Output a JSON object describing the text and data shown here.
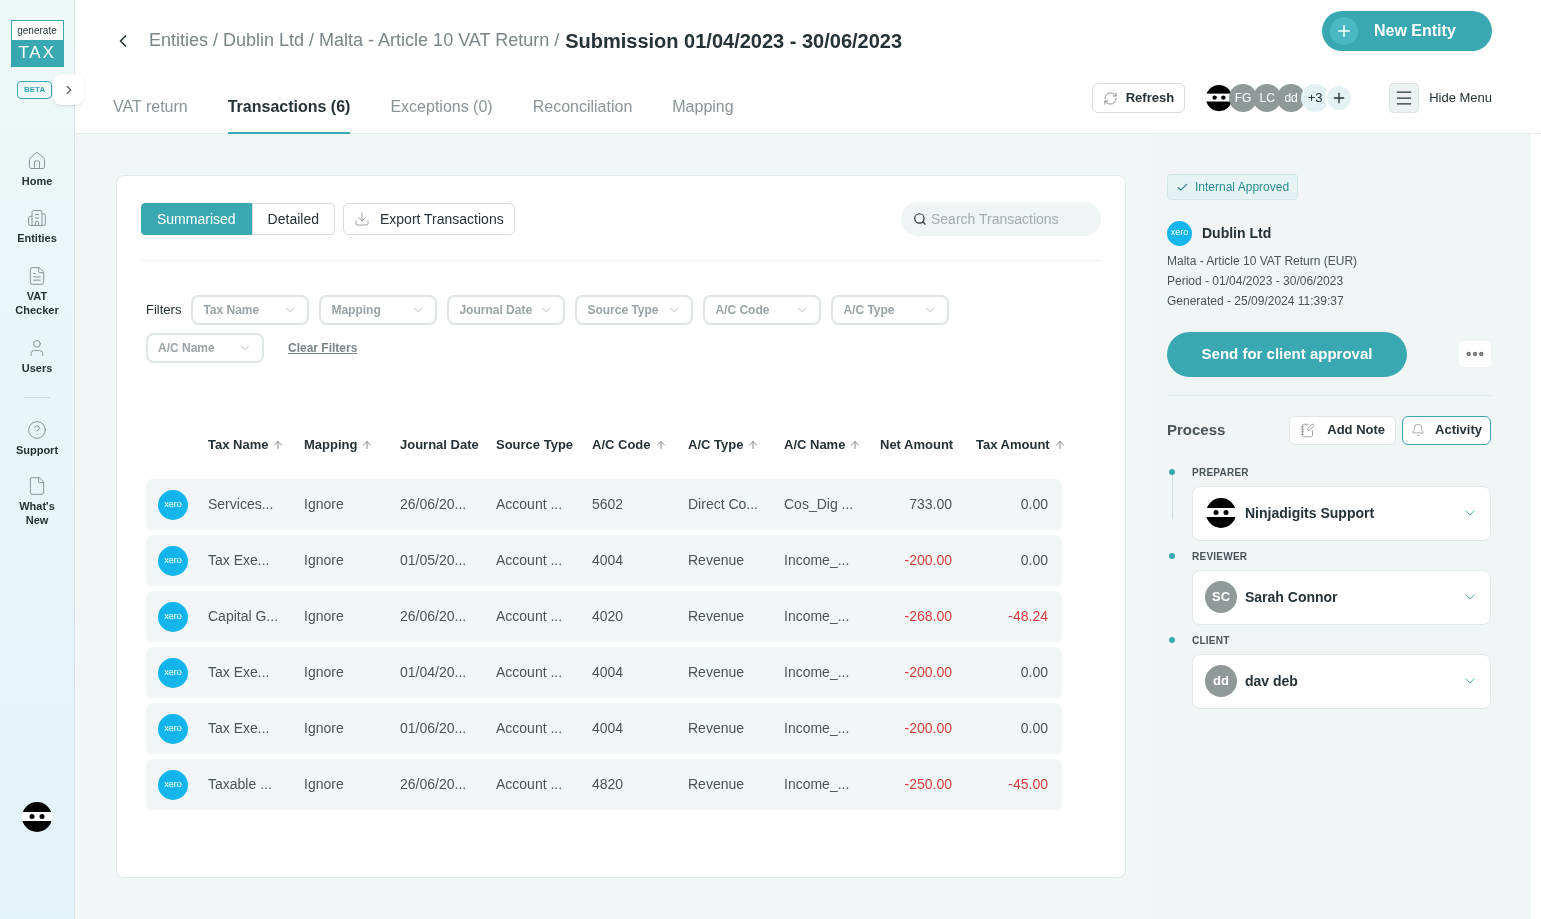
{
  "logo": {
    "top": "generate",
    "bottom": "TAX",
    "badge": "BETA"
  },
  "sidebar": {
    "items": [
      {
        "label": "Home"
      },
      {
        "label": "Entities"
      },
      {
        "label": "VAT Checker"
      },
      {
        "label": "Users"
      }
    ],
    "bottom_items": [
      {
        "label": "Support"
      },
      {
        "label": "What's New"
      }
    ]
  },
  "breadcrumb": {
    "path": "Entities / Dublin Ltd / Malta - Article 10 VAT Return /",
    "current": "Submission 01/04/2023 - 30/06/2023"
  },
  "new_entity_button": "New Entity",
  "tabs": [
    {
      "label": "VAT return",
      "selected": false
    },
    {
      "label": "Transactions (6)",
      "selected": true
    },
    {
      "label": "Exceptions (0)",
      "selected": false
    },
    {
      "label": "Reconciliation",
      "selected": false
    },
    {
      "label": "Mapping",
      "selected": false
    }
  ],
  "refresh_button": "Refresh",
  "collaborators": [
    {
      "kind": "ninja"
    },
    {
      "kind": "initials",
      "initials": "FG"
    },
    {
      "kind": "initials",
      "initials": "LC"
    },
    {
      "kind": "initials",
      "initials": "dd"
    },
    {
      "kind": "more",
      "initials": "+3"
    }
  ],
  "hide_menu": "Hide Menu",
  "view_toggle": [
    {
      "label": "Summarised",
      "selected": true
    },
    {
      "label": "Detailed",
      "selected": false
    }
  ],
  "export_button": "Export Transactions",
  "search": {
    "placeholder": "Search Transactions"
  },
  "filters_label": "Filters",
  "filters": [
    "Tax Name",
    "Mapping",
    "Journal Date",
    "Source Type",
    "A/C Code",
    "A/C Type",
    "A/C Name"
  ],
  "clear_filters": "Clear Filters",
  "table": {
    "columns": [
      {
        "label": "Tax Name",
        "sortable": true
      },
      {
        "label": "Mapping",
        "sortable": true
      },
      {
        "label": "Journal Date",
        "sortable": false
      },
      {
        "label": "Source Type",
        "sortable": false
      },
      {
        "label": "A/C Code",
        "sortable": true
      },
      {
        "label": "A/C Type",
        "sortable": true
      },
      {
        "label": "A/C Name",
        "sortable": true
      },
      {
        "label": "Net Amount",
        "sortable": false
      },
      {
        "label": "Tax Amount",
        "sortable": true
      }
    ],
    "rows": [
      {
        "source": "xero",
        "tax_name": "Services...",
        "mapping": "Ignore",
        "journal_date": "26/06/20...",
        "source_type": "Account ...",
        "ac_code": "5602",
        "ac_type": "Direct Co...",
        "ac_name": "Cos_Dig ...",
        "net_amount": "733.00",
        "net_negative": false,
        "tax_amount": "0.00",
        "tax_negative": false
      },
      {
        "source": "xero",
        "tax_name": "Tax Exe...",
        "mapping": "Ignore",
        "journal_date": "01/05/20...",
        "source_type": "Account ...",
        "ac_code": "4004",
        "ac_type": "Revenue",
        "ac_name": "Income_...",
        "net_amount": "-200.00",
        "net_negative": true,
        "tax_amount": "0.00",
        "tax_negative": false
      },
      {
        "source": "xero",
        "tax_name": "Capital G...",
        "mapping": "Ignore",
        "journal_date": "26/06/20...",
        "source_type": "Account ...",
        "ac_code": "4020",
        "ac_type": "Revenue",
        "ac_name": "Income_...",
        "net_amount": "-268.00",
        "net_negative": true,
        "tax_amount": "-48.24",
        "tax_negative": true
      },
      {
        "source": "xero",
        "tax_name": "Tax Exe...",
        "mapping": "Ignore",
        "journal_date": "01/04/20...",
        "source_type": "Account ...",
        "ac_code": "4004",
        "ac_type": "Revenue",
        "ac_name": "Income_...",
        "net_amount": "-200.00",
        "net_negative": true,
        "tax_amount": "0.00",
        "tax_negative": false
      },
      {
        "source": "xero",
        "tax_name": "Tax Exe...",
        "mapping": "Ignore",
        "journal_date": "01/06/20...",
        "source_type": "Account ...",
        "ac_code": "4004",
        "ac_type": "Revenue",
        "ac_name": "Income_...",
        "net_amount": "-200.00",
        "net_negative": true,
        "tax_amount": "0.00",
        "tax_negative": false
      },
      {
        "source": "xero",
        "tax_name": "Taxable ...",
        "mapping": "Ignore",
        "journal_date": "26/06/20...",
        "source_type": "Account ...",
        "ac_code": "4820",
        "ac_type": "Revenue",
        "ac_name": "Income_...",
        "net_amount": "-250.00",
        "net_negative": true,
        "tax_amount": "-45.00",
        "tax_negative": true
      }
    ]
  },
  "panel": {
    "status": "Internal Approved",
    "source": "xero",
    "entity": "Dublin Ltd",
    "lines": [
      "Malta - Article 10 VAT Return (EUR)",
      "Period - 01/04/2023 - 30/06/2023",
      "Generated - 25/09/2024 11:39:37"
    ],
    "send_button": "Send for client approval",
    "process_title": "Process",
    "add_note": "Add Note",
    "activity": "Activity",
    "roles": [
      {
        "role": "PREPARER",
        "name": "Ninjadigits Support",
        "kind": "ninja"
      },
      {
        "role": "REVIEWER",
        "name": "Sarah Connor",
        "kind": "initials",
        "initials": "SC"
      },
      {
        "role": "CLIENT",
        "name": "dav deb",
        "kind": "initials",
        "initials": "dd"
      }
    ]
  }
}
